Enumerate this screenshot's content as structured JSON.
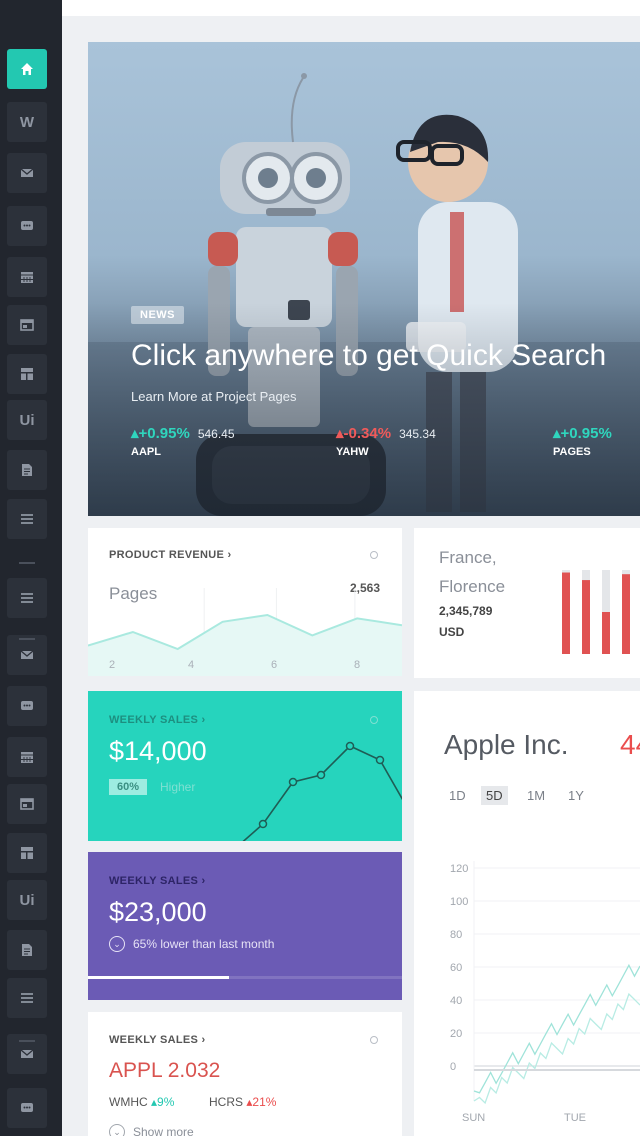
{
  "sidebar": {
    "items": [
      {
        "label": "",
        "icon": "home-icon",
        "active": true
      },
      {
        "label": "W",
        "icon": "widgets-icon"
      },
      {
        "label": "",
        "icon": "mail-icon"
      },
      {
        "label": "",
        "icon": "chat-icon"
      },
      {
        "label": "",
        "icon": "calendar-icon"
      },
      {
        "label": "",
        "icon": "browser-icon"
      },
      {
        "label": "",
        "icon": "layout-icon"
      },
      {
        "label": "Ui",
        "icon": "ui-icon"
      },
      {
        "label": "",
        "icon": "document-icon"
      },
      {
        "label": "",
        "icon": "list-icon"
      },
      {
        "label": "",
        "icon": "list-icon"
      },
      {
        "label": "",
        "icon": "mail-icon"
      },
      {
        "label": "",
        "icon": "chat-icon"
      },
      {
        "label": "",
        "icon": "calendar-icon"
      },
      {
        "label": "",
        "icon": "browser-icon"
      },
      {
        "label": "",
        "icon": "layout-icon"
      },
      {
        "label": "Ui",
        "icon": "ui-icon"
      },
      {
        "label": "",
        "icon": "document-icon"
      },
      {
        "label": "",
        "icon": "list-icon"
      },
      {
        "label": "",
        "icon": "mail-icon"
      },
      {
        "label": "",
        "icon": "chat-icon"
      }
    ],
    "accent": "#23c8b1"
  },
  "hero": {
    "badge": "NEWS",
    "title": "Click anywhere to get Quick Search",
    "subtitle": "Learn More at Project Pages",
    "tickers": [
      {
        "change": "+0.95%",
        "direction": "up",
        "price": "546.45",
        "symbol": "AAPL"
      },
      {
        "change": "-0.34%",
        "direction": "down",
        "price": "345.34",
        "symbol": "YAHW"
      },
      {
        "change": "+0.95%",
        "direction": "up",
        "price": "",
        "symbol": "PAGES"
      }
    ]
  },
  "product_revenue": {
    "label": "PRODUCT REVENUE",
    "metric": "Pages",
    "value": "2,563",
    "x_labels": [
      "2",
      "4",
      "6",
      "8"
    ],
    "series": [
      3,
      5,
      2.5,
      6.5,
      7.5,
      4.5,
      7,
      6
    ]
  },
  "location": {
    "city1": "France,",
    "city2": "Florence",
    "value": "2,345,789",
    "unit": "USD",
    "bar_levels": [
      0.97,
      0.88,
      0.5,
      0.95
    ]
  },
  "weekly_sales_1": {
    "label": "WEEKLY SALES",
    "amount": "$14,000",
    "percent": "60%",
    "note": "Higher",
    "bg": "#26d4bd"
  },
  "weekly_sales_2": {
    "label": "WEEKLY SALES",
    "amount": "$23,000",
    "note": "65% lower than last month",
    "progress": 0.45,
    "bg": "#6b5bb5"
  },
  "weekly_sales_3": {
    "label": "WEEKLY SALES",
    "ticker": "APPL 2.032",
    "stats": [
      {
        "name": "WMHC",
        "change": "9%",
        "direction": "up"
      },
      {
        "name": "HCRS",
        "change": "21%",
        "direction": "up"
      }
    ],
    "show_more": "Show more"
  },
  "apple": {
    "title": "Apple Inc.",
    "value": "44",
    "ranges": [
      "1D",
      "5D",
      "1M",
      "1Y"
    ],
    "active_range": "5D",
    "y_ticks": [
      "120",
      "100",
      "80",
      "60",
      "40",
      "20",
      "0"
    ],
    "x_ticks": [
      "SUN",
      "TUE"
    ]
  }
}
